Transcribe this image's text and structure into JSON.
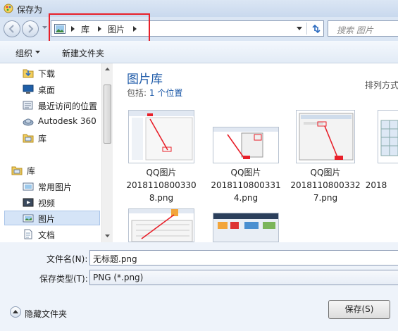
{
  "window": {
    "title": "保存为"
  },
  "address_bar": {
    "crumbs": [
      "库",
      "图片"
    ],
    "search_placeholder": "搜索 图片"
  },
  "toolbar": {
    "organize_label": "组织",
    "new_folder_label": "新建文件夹"
  },
  "sidebar": {
    "items": [
      {
        "label": "下载",
        "icon": "download-folder-icon"
      },
      {
        "label": "桌面",
        "icon": "desktop-icon"
      },
      {
        "label": "最近访问的位置",
        "icon": "recent-places-icon"
      },
      {
        "label": "Autodesk 360",
        "icon": "cloud-icon"
      },
      {
        "label": "库",
        "icon": "library-icon"
      },
      {
        "label": "库",
        "icon": "library-icon"
      },
      {
        "label": "常用图片",
        "icon": "pictures-icon"
      },
      {
        "label": "视频",
        "icon": "video-icon"
      },
      {
        "label": "图片",
        "icon": "pictures-icon"
      },
      {
        "label": "文档",
        "icon": "document-icon"
      }
    ],
    "selected_index": 8
  },
  "main": {
    "library_title": "图片库",
    "includes_label": "包括:",
    "includes_link": "1 个位置",
    "sort_label": "排列方式",
    "files": [
      {
        "line1": "QQ图片",
        "line2": "2018110800330",
        "line3": "8.png"
      },
      {
        "line1": "QQ图片",
        "line2": "2018110800331",
        "line3": "4.png"
      },
      {
        "line1": "QQ图片",
        "line2": "2018110800332",
        "line3": "7.png"
      },
      {
        "line1": "",
        "line2": "2018",
        "line3": ""
      }
    ]
  },
  "bottom": {
    "filename_label": "文件名(N):",
    "filename_value": "无标题.png",
    "filetype_label": "保存类型(T):",
    "filetype_value": "PNG (*.png)",
    "hide_folders_label": "隐藏文件夹",
    "save_label": "保存(S)"
  },
  "colors": {
    "accent": "#1e5aa8",
    "highlight": "#e8202a",
    "selection": "#d5e4f7"
  }
}
